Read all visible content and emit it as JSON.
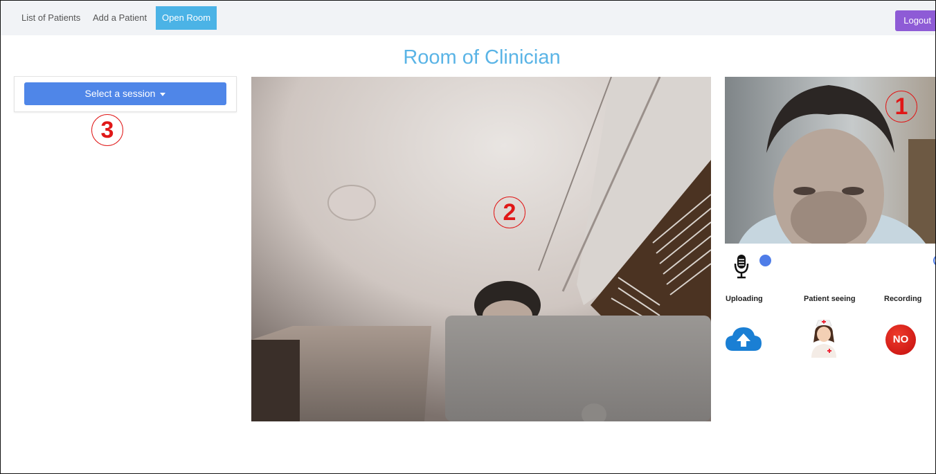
{
  "navbar": {
    "links": [
      "List of Patients",
      "Add a Patient",
      "Open Room"
    ],
    "logout_label": "Logout"
  },
  "page_title": "Room of Clinician",
  "session": {
    "button_label": "Select a session"
  },
  "callouts": [
    "1",
    "2",
    "3"
  ],
  "status": {
    "uploading_label": "Uploading",
    "patient_seeing_label": "Patient seeing",
    "recording_label": "Recording",
    "recording_value": "NO"
  },
  "colors": {
    "accent": "#4bb3e6",
    "title": "#5ab4e6",
    "session_button": "#4f86e8",
    "logout": "#8e5bd6",
    "callout": "#e01818",
    "upload_icon": "#1a7fd4",
    "mic_dot": "#4f7de8"
  },
  "icons": [
    "microphone-icon",
    "cloud-upload-icon",
    "nurse-icon",
    "no-badge-icon",
    "caret-down-icon"
  ]
}
